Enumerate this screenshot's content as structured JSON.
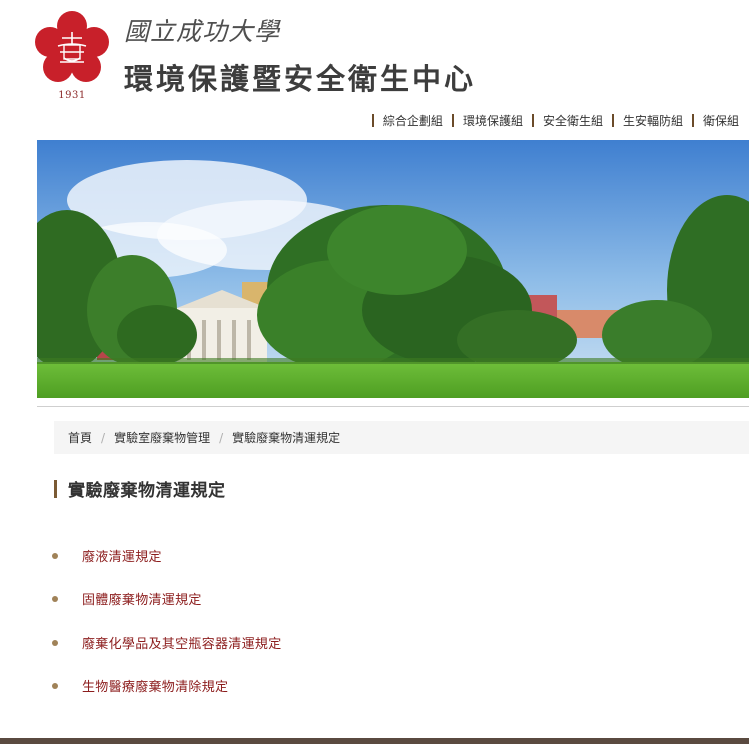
{
  "header": {
    "university_name": "國立成功大學",
    "center_name": "環境保護暨安全衛生中心",
    "logo_year": "1931"
  },
  "nav": {
    "items": [
      {
        "label": "綜合企劃組"
      },
      {
        "label": "環境保護組"
      },
      {
        "label": "安全衛生組"
      },
      {
        "label": "生安輻防組"
      },
      {
        "label": "衛保組"
      }
    ]
  },
  "banner": {
    "icon": "campus-banyan-tree-photo"
  },
  "breadcrumb": {
    "home": "首頁",
    "section": "實驗室廢棄物管理",
    "current": "實驗廢棄物清運規定"
  },
  "page": {
    "title": "實驗廢棄物清運規定"
  },
  "links": [
    {
      "label": "廢液清運規定"
    },
    {
      "label": "固體廢棄物清運規定"
    },
    {
      "label": "廢棄化學品及其空瓶容器清運規定"
    },
    {
      "label": "生物醫療廢棄物清除規定"
    }
  ],
  "colors": {
    "brand_red": "#c8202a",
    "link": "#8c1d1d",
    "accent_bar": "#7a5a34",
    "bullet": "#a08258"
  }
}
